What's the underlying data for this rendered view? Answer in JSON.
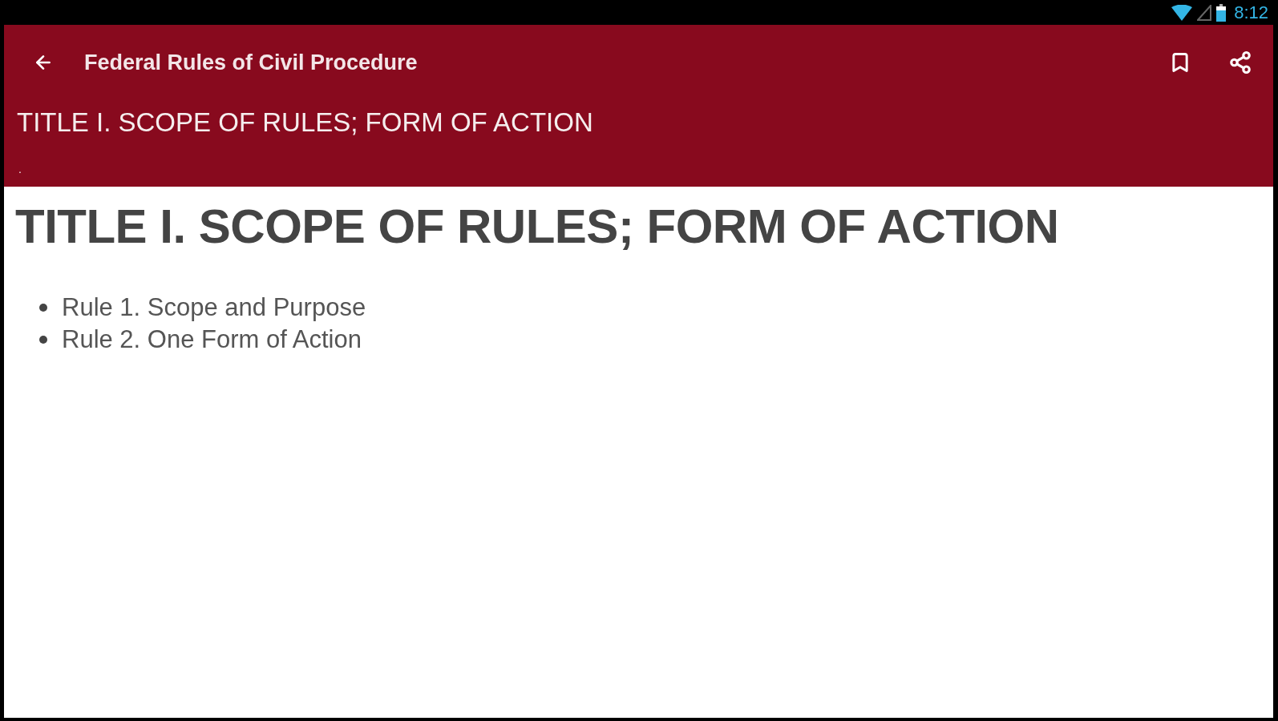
{
  "status_bar": {
    "time": "8:12"
  },
  "toolbar": {
    "title": "Federal Rules of Civil Procedure"
  },
  "header": {
    "subtitle": "TITLE I. SCOPE OF RULES; FORM OF ACTION",
    "note": "."
  },
  "content": {
    "heading": "TITLE I. SCOPE OF RULES; FORM OF ACTION",
    "links": [
      {
        "label": "Rule 1. Scope and Purpose"
      },
      {
        "label": "Rule 2. One Form of Action"
      }
    ]
  }
}
